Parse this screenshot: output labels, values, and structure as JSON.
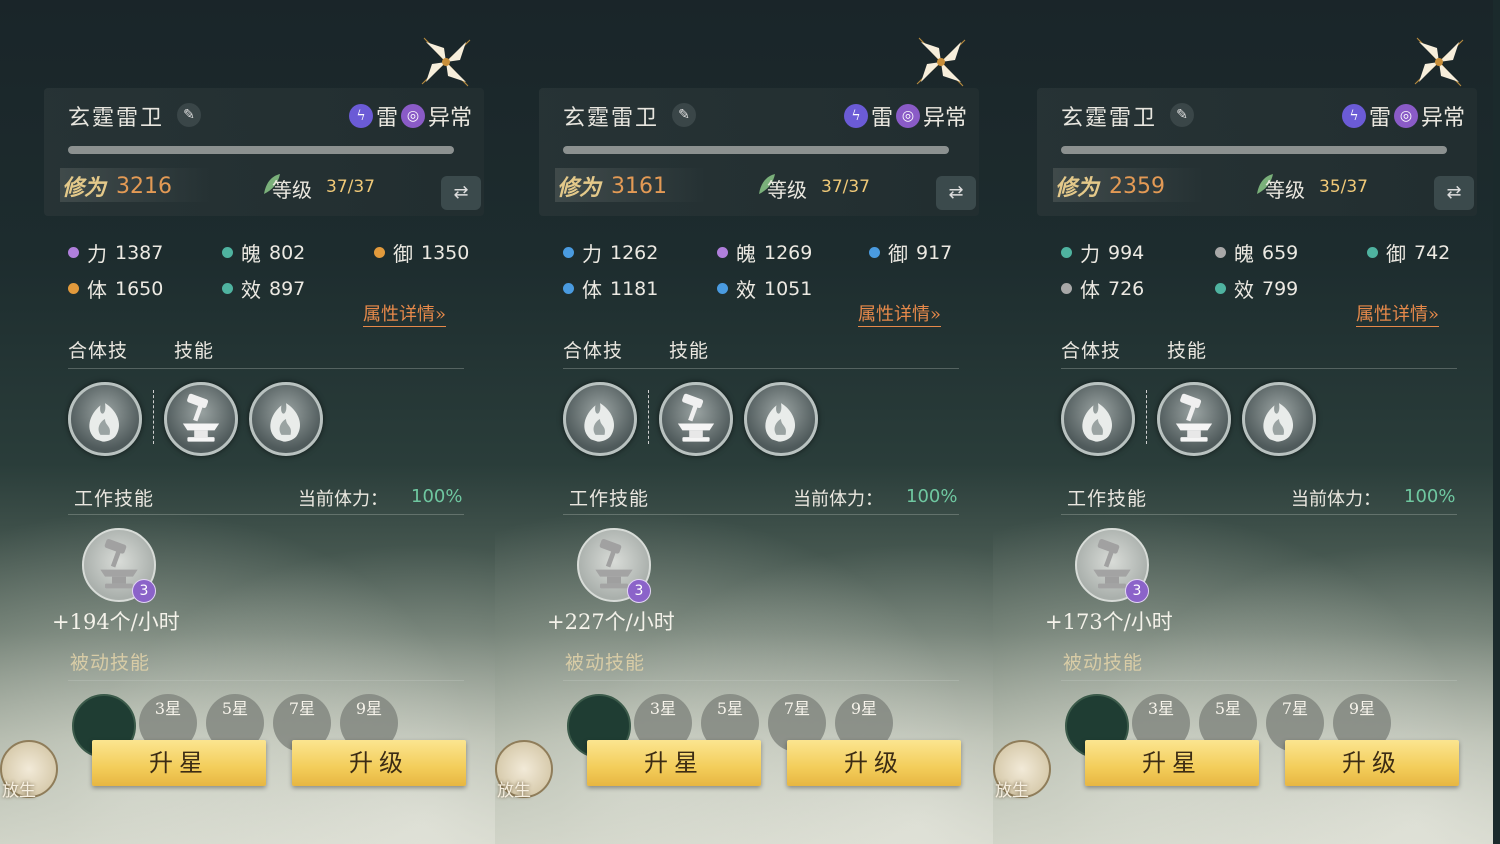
{
  "panels": [
    {
      "name": "玄霆雷卫",
      "elements": [
        "雷",
        "异常"
      ],
      "power_label": "修为",
      "power": "3216",
      "level_label": "等级",
      "level": "37/37",
      "stats": [
        {
          "label": "力",
          "value": "1387",
          "color": "#b07fdc"
        },
        {
          "label": "魄",
          "value": "802",
          "color": "#4fb3a0"
        },
        {
          "label": "御",
          "value": "1350",
          "color": "#e29a3c"
        },
        {
          "label": "体",
          "value": "1650",
          "color": "#e29a3c"
        },
        {
          "label": "效",
          "value": "897",
          "color": "#4fb3a0"
        }
      ],
      "details_link": "属性详情»",
      "tab_combo": "合体技",
      "tab_skills": "技能",
      "work_skill_title": "工作技能",
      "stamina_label": "当前体力：",
      "stamina_value": "100%",
      "work_badge": "3",
      "rate": "+194个/小时",
      "passive_title": "被动技能",
      "stars": [
        "3星",
        "5星",
        "7星",
        "9星"
      ],
      "btn_star": "升星",
      "btn_level": "升级",
      "release": "放生"
    },
    {
      "name": "玄霆雷卫",
      "elements": [
        "雷",
        "异常"
      ],
      "power_label": "修为",
      "power": "3161",
      "level_label": "等级",
      "level": "37/37",
      "stats": [
        {
          "label": "力",
          "value": "1262",
          "color": "#4a9be0"
        },
        {
          "label": "魄",
          "value": "1269",
          "color": "#b07fdc"
        },
        {
          "label": "御",
          "value": "917",
          "color": "#4a9be0"
        },
        {
          "label": "体",
          "value": "1181",
          "color": "#4a9be0"
        },
        {
          "label": "效",
          "value": "1051",
          "color": "#4a9be0"
        }
      ],
      "details_link": "属性详情»",
      "tab_combo": "合体技",
      "tab_skills": "技能",
      "work_skill_title": "工作技能",
      "stamina_label": "当前体力：",
      "stamina_value": "100%",
      "work_badge": "3",
      "rate": "+227个/小时",
      "passive_title": "被动技能",
      "stars": [
        "3星",
        "5星",
        "7星",
        "9星"
      ],
      "btn_star": "升星",
      "btn_level": "升级",
      "release": "放生"
    },
    {
      "name": "玄霆雷卫",
      "elements": [
        "雷",
        "异常"
      ],
      "power_label": "修为",
      "power": "2359",
      "level_label": "等级",
      "level": "35/37",
      "stats": [
        {
          "label": "力",
          "value": "994",
          "color": "#4fb3a0"
        },
        {
          "label": "魄",
          "value": "659",
          "color": "#a8a8a8"
        },
        {
          "label": "御",
          "value": "742",
          "color": "#4fb3a0"
        },
        {
          "label": "体",
          "value": "726",
          "color": "#a8a8a8"
        },
        {
          "label": "效",
          "value": "799",
          "color": "#4fb3a0"
        }
      ],
      "details_link": "属性详情»",
      "tab_combo": "合体技",
      "tab_skills": "技能",
      "work_skill_title": "工作技能",
      "stamina_label": "当前体力：",
      "stamina_value": "100%",
      "work_badge": "3",
      "rate": "+173个/小时",
      "passive_title": "被动技能",
      "stars": [
        "3星",
        "5星",
        "7星",
        "9星"
      ],
      "btn_star": "升星",
      "btn_level": "升级",
      "release": "放生"
    }
  ]
}
